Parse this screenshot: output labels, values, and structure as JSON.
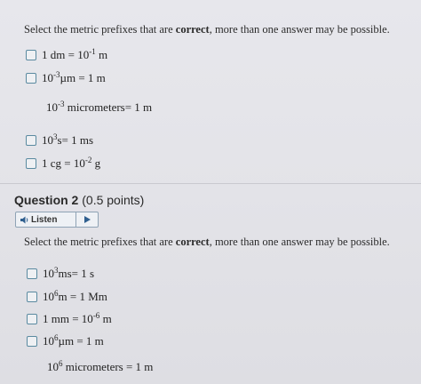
{
  "question1": {
    "prompt_before": "Select the metric prefixes that are ",
    "prompt_bold": "correct",
    "prompt_after": ", more than one answer may be possible.",
    "options": [
      {
        "base": "1 dm = 10",
        "sup": "-1",
        "after": " m"
      },
      {
        "base": "10",
        "sup": "-3",
        "after": "µm = 1 m"
      },
      {
        "base": "10",
        "sup": "3",
        "after": "s= 1 ms"
      },
      {
        "base": "1 cg = 10",
        "sup": "-2",
        "after": " g"
      }
    ],
    "note": {
      "base": "10",
      "sup": "-3",
      "after": " micrometers= 1 m"
    }
  },
  "question2": {
    "title": "Question 2",
    "points": "(0.5 points)",
    "listen_label": "Listen",
    "prompt_before": "Select the metric prefixes that are ",
    "prompt_bold": "correct",
    "prompt_after": ", more than one answer may be possible.",
    "options": [
      {
        "base": "10",
        "sup": "3",
        "after": "ms= 1 s"
      },
      {
        "base": "10",
        "sup": "6",
        "after": "m = 1 Mm"
      },
      {
        "base": "1 mm = 10",
        "sup": "-6",
        "after": " m"
      },
      {
        "base": "10",
        "sup": "6",
        "after": "µm = 1 m"
      }
    ],
    "note": {
      "base": "10",
      "sup": "6",
      "after": " micrometers = 1 m"
    }
  },
  "icons": {
    "checkbox": "checkbox-icon",
    "speaker": "speaker-icon",
    "play": "play-icon"
  },
  "colors": {
    "checkbox_border": "#5a8aa0",
    "listen_border": "#8fa3b5",
    "listen_icon": "#2f5f8f"
  }
}
